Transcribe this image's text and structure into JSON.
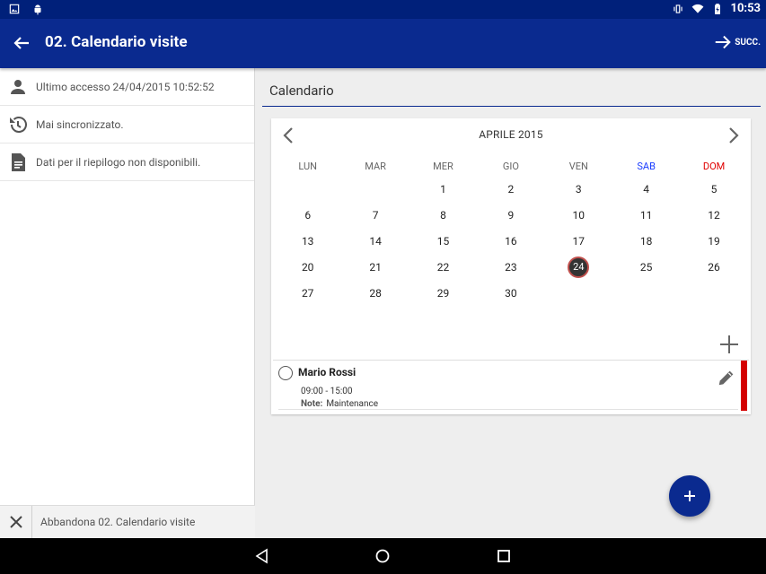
{
  "status_bar": {
    "time": "10:53",
    "icons": [
      "image-icon",
      "android-icon",
      "vibrate-icon",
      "wifi-icon",
      "battery-icon"
    ]
  },
  "app_bar": {
    "title": "02. Calendario visite",
    "next_label": "SUCC.",
    "back_icon": "arrow-back-icon"
  },
  "left_panel": {
    "rows": [
      {
        "icon": "person-icon",
        "text": "Ultimo accesso 24/04/2015 10:52:52"
      },
      {
        "icon": "history-icon",
        "text": "Mai sincronizzato."
      },
      {
        "icon": "document-icon",
        "text": "Dati per il riepilogo non disponibili."
      }
    ],
    "abandon_label": "Abbandona 02. Calendario visite"
  },
  "section": {
    "title": "Calendario"
  },
  "calendar": {
    "month": "APRILE 2015",
    "weekdays": [
      "LUN",
      "MAR",
      "MER",
      "GIO",
      "VEN",
      "SAB",
      "DOM"
    ],
    "weeks": [
      [
        "",
        "",
        "1",
        "2",
        "3",
        "4",
        "5"
      ],
      [
        "6",
        "7",
        "8",
        "9",
        "10",
        "11",
        "12"
      ],
      [
        "13",
        "14",
        "15",
        "16",
        "17",
        "18",
        "19"
      ],
      [
        "20",
        "21",
        "22",
        "23",
        "24",
        "25",
        "26"
      ],
      [
        "27",
        "28",
        "29",
        "30",
        "",
        "",
        ""
      ]
    ],
    "selected_day": "24"
  },
  "event": {
    "name": "Mario Rossi",
    "time": "09:00 - 15:00",
    "note_label": "Note:",
    "note_value": "Maintenance",
    "bar_color": "#d40000"
  },
  "colors": {
    "primary": "#0a2a8f",
    "status": "#00207a",
    "saturday": "#1a3cff",
    "sunday": "#e00000"
  }
}
